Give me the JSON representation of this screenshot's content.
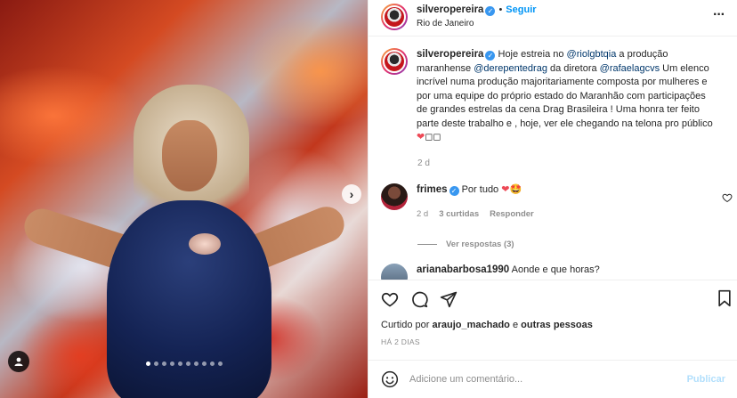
{
  "post": {
    "username": "silveropereira",
    "follow_label": "Seguir",
    "separator": "•",
    "location": "Rio de Janeiro",
    "more_icon": "more-horizontal-icon"
  },
  "caption": {
    "username": "silveropereira",
    "part1": "Hoje estreia no ",
    "mention1": "@riolgbtqia",
    "part2": " a produção maranhense ",
    "mention2": "@derepentedrag",
    "part3": " da diretora ",
    "mention3": "@rafaelagcvs",
    "part4": " Um elenco incrível numa produção majoritariamente composta por mulheres e por uma equipe do próprio estado do Maranhão com participações de grandes estrelas da cena Drag Brasileira ! Uma honra ter feito parte deste trabalho e , hoje, ver ele chegando na telona pro público ",
    "emoji_end": "❤",
    "emoji_tail": "◻◻",
    "time": "2 d"
  },
  "comments": [
    {
      "username": "frimes",
      "text": "Por tudo ",
      "emoji": "❤🤩",
      "time": "2 d",
      "likes": "3 curtidas",
      "reply_label": "Responder",
      "view_replies": "Ver respostas (3)"
    },
    {
      "username": "arianabarbosa1990",
      "text": "Aonde e que horas?"
    }
  ],
  "actions": {
    "like_icon": "heart-icon",
    "comment_icon": "comment-icon",
    "share_icon": "send-icon",
    "save_icon": "bookmark-icon"
  },
  "liked_by": {
    "prefix": "Curtido por ",
    "user": "araujo_machado",
    "middle": " e ",
    "others": "outras pessoas"
  },
  "post_date": "HÁ 2 DIAS",
  "add_comment": {
    "placeholder": "Adicione um comentário...",
    "publish_label": "Publicar"
  },
  "colors": {
    "accent": "#0095f6",
    "verified": "#3897f0",
    "heart": "#ed4956",
    "muted": "#8e8e8e"
  }
}
